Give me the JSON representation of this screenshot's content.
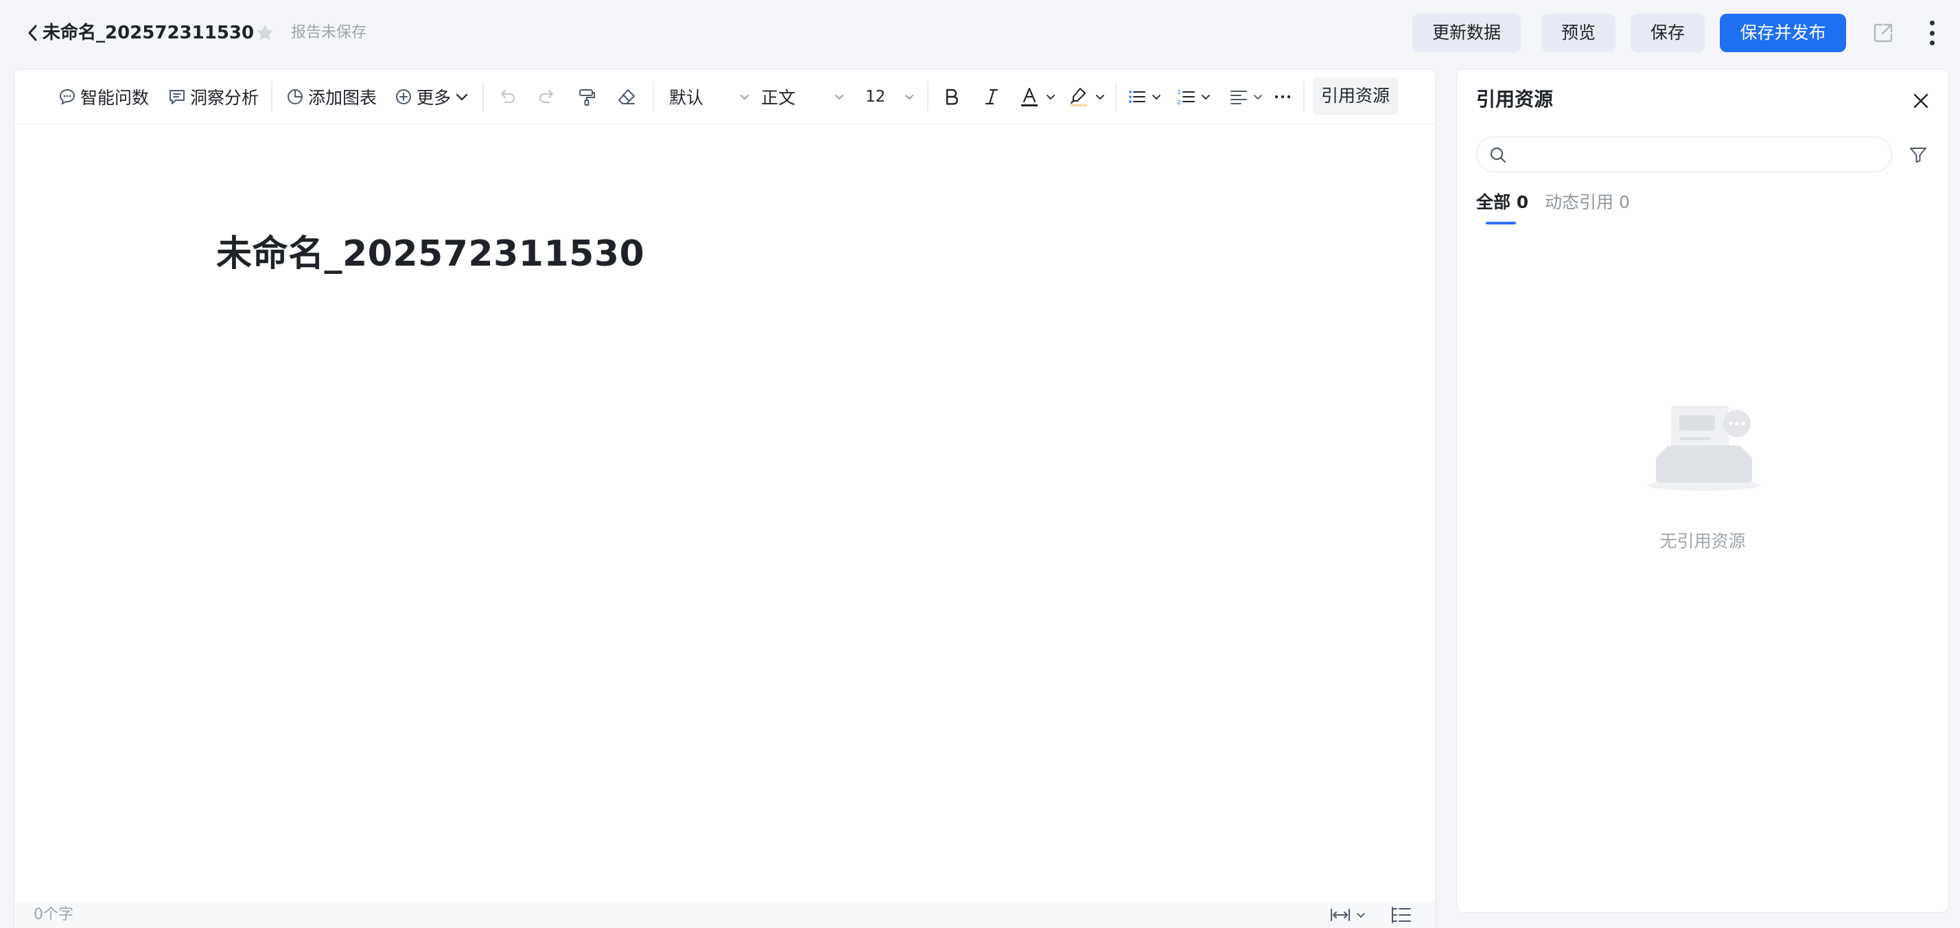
{
  "header": {
    "title": "未命名_202572311530",
    "save_status": "报告未保存",
    "buttons": {
      "refresh": "更新数据",
      "preview": "预览",
      "save": "保存",
      "publish": "保存并发布"
    }
  },
  "toolbar": {
    "ask": "智能问数",
    "insight": "洞察分析",
    "add_chart": "添加图表",
    "more": "更多",
    "font_family": "默认",
    "paragraph_style": "正文",
    "font_size": "12",
    "reference": "引用资源"
  },
  "document": {
    "heading": "未命名_202572311530"
  },
  "status_bar": {
    "word_count": "0个字"
  },
  "reference_panel": {
    "title": "引用资源",
    "search_placeholder": "",
    "tabs": [
      {
        "label": "全部 0",
        "active": true
      },
      {
        "label": "动态引用 0",
        "active": false
      }
    ],
    "empty_text": "无引用资源"
  },
  "colors": {
    "primary": "#1f6ff2",
    "tab_active": "#3370ff",
    "text": "#1f2329",
    "muted": "#a0a5ad"
  }
}
